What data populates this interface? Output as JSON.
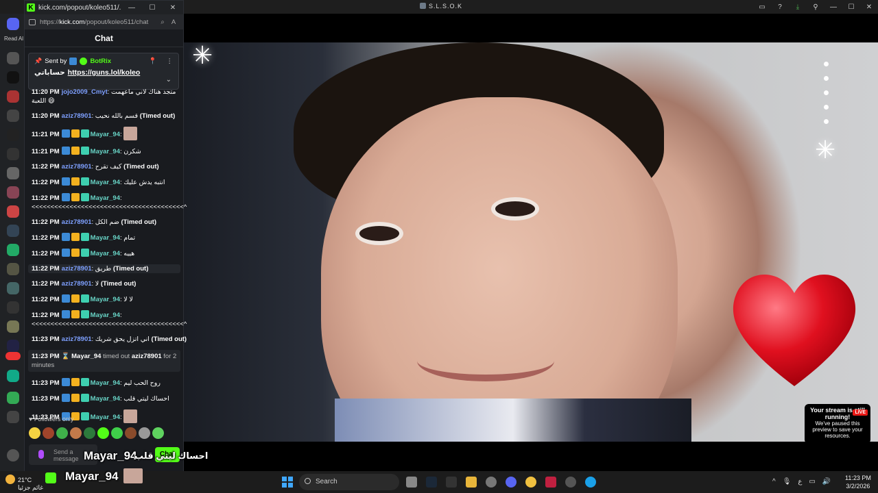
{
  "host": {
    "title": "S.L.S.O.K",
    "left_label": "Read Al"
  },
  "popout": {
    "title": "kick.com/popout/koleo511/...",
    "url_prefix": "https://",
    "url_domain": "kick.com",
    "url_path": "/popout/koleo511/chat",
    "chat_heading": "Chat"
  },
  "pinned": {
    "sent_by": "Sent by",
    "author": "BotRix",
    "text_ar": "حساباتي",
    "link": "https://guns.lol/koleo"
  },
  "messages": [
    {
      "time": "11:20 PM",
      "user": "jojo2009_Cmyt",
      "text": "متجد هناك لاني ماعهمت اللعبة 😄",
      "color": "blue",
      "badges": 0,
      "wrap": true
    },
    {
      "time": "11:20 PM",
      "user": "aziz78901",
      "text": "قسم بالله نحيب",
      "note": "(Timed out)",
      "color": "blue",
      "badges": 0
    },
    {
      "time": "11:21 PM",
      "user": "Mayar_94",
      "text": "",
      "color": "teal",
      "badges": 3,
      "emote": true
    },
    {
      "time": "11:21 PM",
      "user": "Mayar_94",
      "text": "شكرن",
      "color": "teal",
      "badges": 3
    },
    {
      "time": "11:22 PM",
      "user": "aziz78901",
      "text": "كيف تقرح",
      "note": "(Timed out)",
      "color": "blue",
      "badges": 0
    },
    {
      "time": "11:22 PM",
      "user": "Mayar_94",
      "text": "انتبه يدش عليك",
      "color": "teal",
      "badges": 3
    },
    {
      "time": "11:22 PM",
      "user": "Mayar_94",
      "text": "<<<<<<<<<<<<<<<<<<<<<<<<<<<<<<<<<<<<<<<<^",
      "color": "teal",
      "badges": 3,
      "wrap": true
    },
    {
      "time": "11:22 PM",
      "user": "aziz78901",
      "text": "ضم الكل",
      "note": "(Timed out)",
      "color": "blue",
      "badges": 0
    },
    {
      "time": "11:22 PM",
      "user": "Mayar_94",
      "text": "تمام",
      "color": "teal",
      "badges": 3
    },
    {
      "time": "11:22 PM",
      "user": "Mayar_94",
      "text": "هييه",
      "color": "teal",
      "badges": 3
    },
    {
      "time": "11:22 PM",
      "user": "aziz78901",
      "text": "طريق",
      "note": "(Timed out)",
      "color": "blue",
      "badges": 0,
      "hl": true
    },
    {
      "time": "11:22 PM",
      "user": "aziz78901",
      "text": "لا",
      "note": "(Timed out)",
      "color": "blue",
      "badges": 0
    },
    {
      "time": "11:22 PM",
      "user": "Mayar_94",
      "text": "لا لا",
      "color": "teal",
      "badges": 3
    },
    {
      "time": "11:22 PM",
      "user": "Mayar_94",
      "text": "<<<<<<<<<<<<<<<<<<<<<<<<<<<<<<<<<<<<<<<<^",
      "color": "teal",
      "badges": 3,
      "wrap": true
    },
    {
      "time": "11:23 PM",
      "user": "aziz78901",
      "text": "اني اتزل يحق شريك",
      "note": "(Timed out)",
      "color": "blue",
      "badges": 0
    },
    {
      "time": "11:23 PM",
      "system": true,
      "actor": "Mayar_94",
      "action": "timed out",
      "target": "aziz78901",
      "rest": "for 2 minutes"
    },
    {
      "time": "11:23 PM",
      "user": "Mayar_94",
      "text": "روح الحب ليم",
      "color": "teal",
      "badges": 3
    },
    {
      "time": "11:23 PM",
      "user": "Mayar_94",
      "text": "احساك ليتي قلب",
      "color": "teal",
      "badges": 3
    },
    {
      "time": "11:23 PM",
      "user": "Mayar_94",
      "text": "",
      "color": "teal",
      "badges": 3,
      "emote": true
    }
  ],
  "chat_footer": {
    "followers_only": "Followers only",
    "input_placeholder": "Send a message",
    "send_label": "Chat"
  },
  "overlay": {
    "name_large": "Mayar_94",
    "name_bottom": "Mayar_94",
    "arabic_text": "احساك ليتي قلب",
    "toast_title": "Your stream is still running!",
    "toast_live": "LIVE",
    "toast_body": "We've paused this preview to save your resources."
  },
  "taskbar": {
    "temp": "21°C",
    "weather_desc": "غائم جزئيا",
    "search": "Search",
    "time": "11:23 PM",
    "date": "3/2/2026",
    "lang": "ع"
  }
}
